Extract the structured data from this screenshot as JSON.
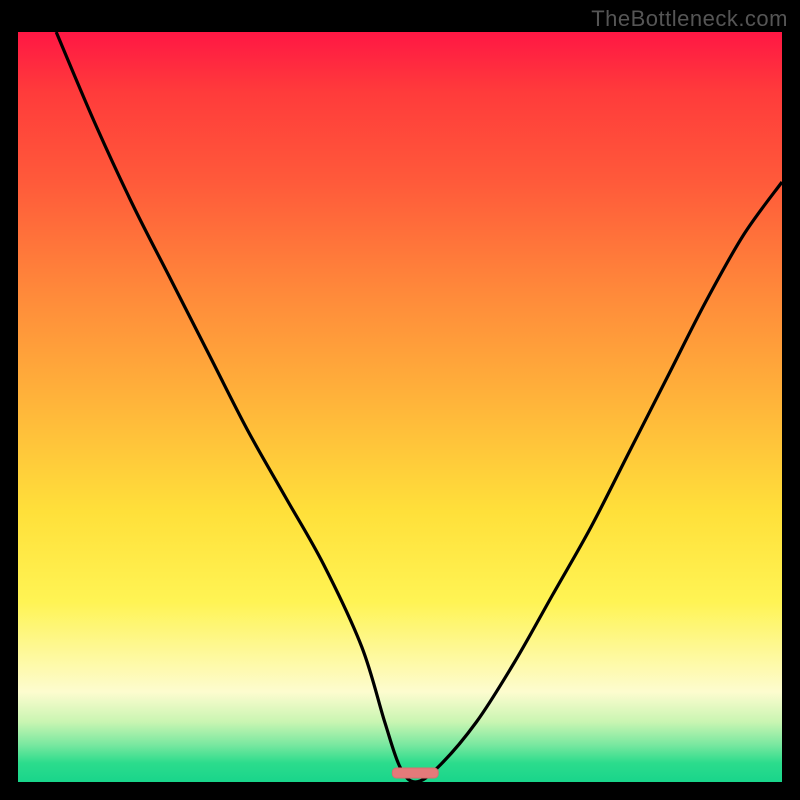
{
  "watermark": "TheBottleneck.com",
  "chart_data": {
    "type": "line",
    "title": "",
    "xlabel": "",
    "ylabel": "",
    "xlim": [
      0,
      100
    ],
    "ylim": [
      0,
      100
    ],
    "grid": false,
    "legend": false,
    "series": [
      {
        "name": "curve",
        "x": [
          5,
          10,
          15,
          20,
          25,
          30,
          35,
          40,
          45,
          48,
          50,
          52,
          55,
          60,
          65,
          70,
          75,
          80,
          85,
          90,
          95,
          100
        ],
        "y": [
          100,
          88,
          77,
          67,
          57,
          47,
          38,
          29,
          18,
          8,
          2,
          0,
          2,
          8,
          16,
          25,
          34,
          44,
          54,
          64,
          73,
          80
        ]
      }
    ],
    "vertex_marker": {
      "x": 52,
      "y": 0,
      "width": 6,
      "color": "#e47a7a"
    },
    "background_gradient": {
      "orientation": "vertical",
      "stops": [
        {
          "pos": 0.0,
          "color": "#ff1744"
        },
        {
          "pos": 0.5,
          "color": "#ffb63a"
        },
        {
          "pos": 0.76,
          "color": "#fff454"
        },
        {
          "pos": 1.0,
          "color": "#19d58b"
        }
      ]
    }
  }
}
